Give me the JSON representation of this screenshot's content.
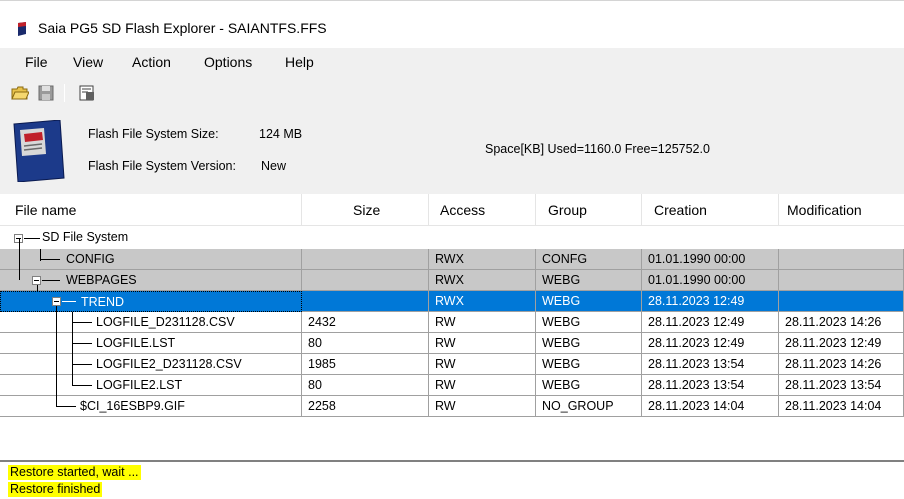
{
  "window": {
    "title": "Saia PG5 SD Flash Explorer - SAIANTFS.FFS"
  },
  "menu": [
    "File",
    "View",
    "Action",
    "Options",
    "Help"
  ],
  "toolbar": {
    "buttons": [
      "open-folder-icon",
      "save-icon",
      "properties-icon"
    ]
  },
  "info": {
    "size_label": "Flash File System Size:",
    "size_value": "124 MB",
    "version_label": "Flash File System Version:",
    "version_value": "New",
    "space": "Space[KB]  Used=1160.0  Free=125752.0"
  },
  "columns": [
    "File name",
    "Size",
    "Access",
    "Group",
    "Creation",
    "Modification"
  ],
  "rows": [
    {
      "name": "SD File System",
      "size": "",
      "access": "",
      "group": "",
      "creation": "",
      "modification": ""
    },
    {
      "name": "CONFIG",
      "size": "",
      "access": "RWX",
      "group": "CONFG",
      "creation": "01.01.1990 00:00",
      "modification": ""
    },
    {
      "name": "WEBPAGES",
      "size": "",
      "access": "RWX",
      "group": "WEBG",
      "creation": "01.01.1990 00:00",
      "modification": ""
    },
    {
      "name": "TREND",
      "size": "",
      "access": "RWX",
      "group": "WEBG",
      "creation": "28.11.2023 12:49",
      "modification": ""
    },
    {
      "name": "LOGFILE_D231128.CSV",
      "size": "2432",
      "access": "RW",
      "group": "WEBG",
      "creation": "28.11.2023 12:49",
      "modification": "28.11.2023 14:26"
    },
    {
      "name": "LOGFILE.LST",
      "size": "80",
      "access": "RW",
      "group": "WEBG",
      "creation": "28.11.2023 12:49",
      "modification": "28.11.2023 12:49"
    },
    {
      "name": "LOGFILE2_D231128.CSV",
      "size": "1985",
      "access": "RW",
      "group": "WEBG",
      "creation": "28.11.2023 13:54",
      "modification": "28.11.2023 14:26"
    },
    {
      "name": "LOGFILE2.LST",
      "size": "80",
      "access": "RW",
      "group": "WEBG",
      "creation": "28.11.2023 13:54",
      "modification": "28.11.2023 13:54"
    },
    {
      "name": "$CI_16ESBP9.GIF",
      "size": "2258",
      "access": "RW",
      "group": "NO_GROUP",
      "creation": "28.11.2023 14:04",
      "modification": "28.11.2023 14:04"
    }
  ],
  "status": [
    "Restore started, wait ...",
    "Restore finished"
  ],
  "colors": {
    "selection": "#0078d7",
    "gray_row": "#c8c8c8",
    "highlight": "#ffff00",
    "chrome": "#f0f0f0"
  }
}
